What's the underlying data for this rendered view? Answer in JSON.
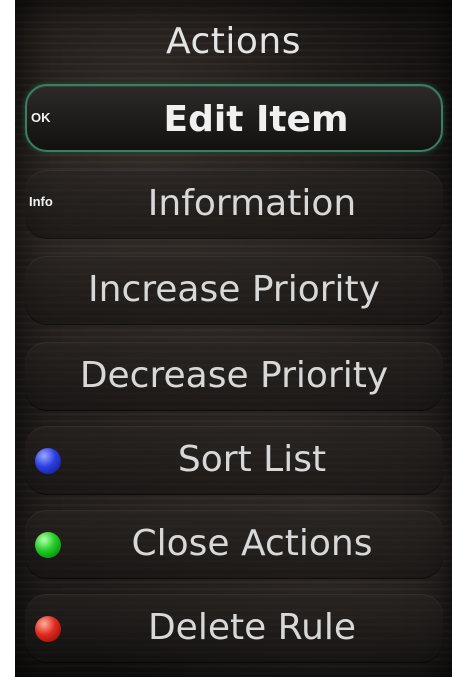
{
  "header": {
    "title": "Actions"
  },
  "menu": {
    "items": [
      {
        "label": "Edit Item",
        "key": "OK",
        "icon": "ok-key-icon",
        "selected": true
      },
      {
        "label": "Information",
        "key": "Info",
        "icon": "info-key-icon",
        "selected": false
      },
      {
        "label": "Increase Priority",
        "key": "",
        "icon": "",
        "selected": false
      },
      {
        "label": "Decrease Priority",
        "key": "",
        "icon": "",
        "selected": false
      },
      {
        "label": "Sort List",
        "key": "",
        "icon": "blue-button-icon",
        "color": "#2b3fe0",
        "selected": false
      },
      {
        "label": "Close Actions",
        "key": "",
        "icon": "green-button-icon",
        "color": "#1fcc24",
        "selected": false
      },
      {
        "label": "Delete Rule",
        "key": "",
        "icon": "red-button-icon",
        "color": "#e02a1c",
        "selected": false
      }
    ]
  },
  "colors": {
    "selection_border": "#3b7f63",
    "text": "#d8d8d8",
    "background": "#1a1716"
  }
}
